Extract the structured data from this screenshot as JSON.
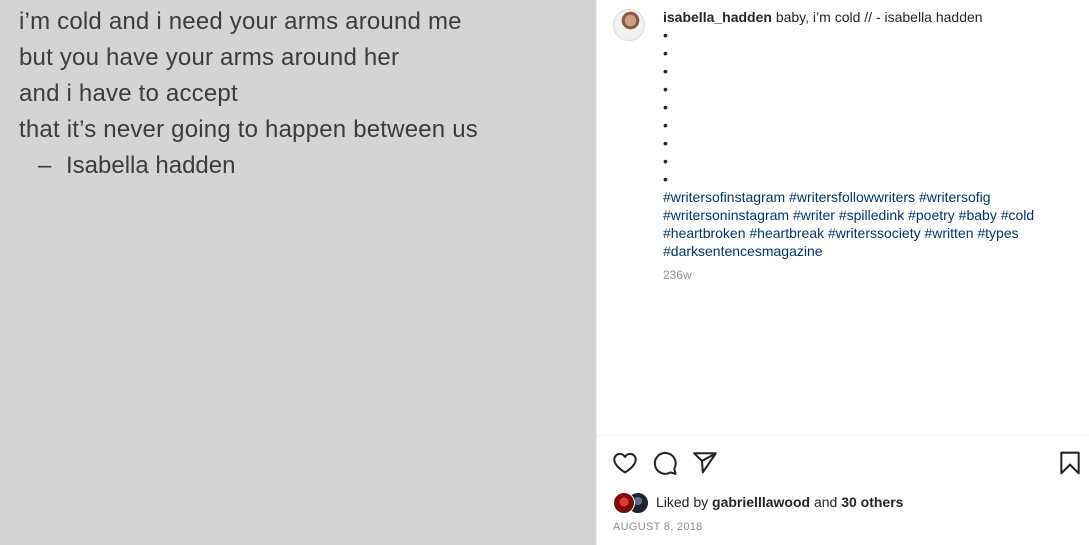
{
  "image": {
    "lines": [
      "i’m cold and i need your arms around me",
      "but you have your arms around her",
      "and i have to accept",
      "that it’s never going to happen between us"
    ],
    "signature_dash": "–",
    "signature_name": "Isabella hadden"
  },
  "post": {
    "username": "isabella_hadden",
    "caption": "baby, i’m cold // - isabella hadden",
    "bullet_count": 9,
    "hashtags": "#writersofinstagram #writersfollowwriters #writersofig #writersoninstagram #writer #spilledink #poetry #baby #cold #heartbroken #heartbreak #writerssociety #written #types #darksentencesmagazine",
    "time_ago": "236w"
  },
  "likes": {
    "prefix": "Liked by",
    "user": "gabrielllawood",
    "and": "and",
    "others": "30 others"
  },
  "date": "August 8, 2018",
  "icons": {
    "like": "heart-icon",
    "comment": "comment-icon",
    "share": "paper-plane-icon",
    "save": "bookmark-icon"
  },
  "colors": {
    "image_bg": "#d4d4d4",
    "hashtag": "#00376b",
    "muted": "#8e8e8e",
    "text": "#262626"
  }
}
